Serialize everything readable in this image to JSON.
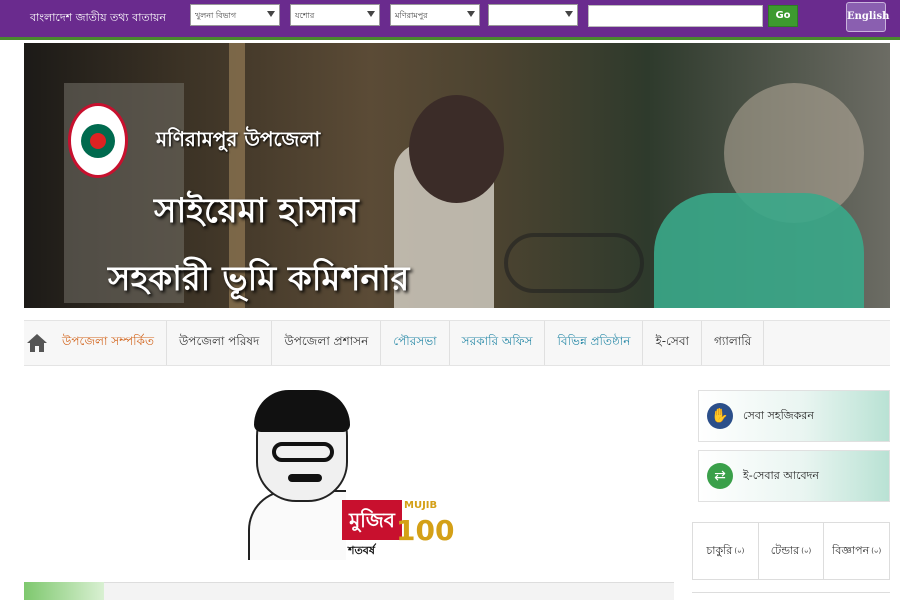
{
  "topbar": {
    "portal_title": "বাংলাদেশ জাতীয় তথ্য বাতায়ন",
    "selects": [
      "খুলনা বিভাগ",
      "যশোর",
      "মণিরামপুর",
      ""
    ],
    "search_value": "",
    "go_label": "Go",
    "lang_label": "English",
    "colors": {
      "bar": "#6a2b8e",
      "go": "#3d9a2f"
    }
  },
  "banner": {
    "upazila": "মণিরামপুর উপজেলা",
    "name": "সাইয়েমা হাসান",
    "role": "সহকারী ভূমি কমিশনার"
  },
  "nav": {
    "home_icon": "home-icon",
    "items": [
      "উপজেলা সম্পর্কিত",
      "উপজেলা পরিষদ",
      "উপজেলা প্রশাসন",
      "পৌরসভা",
      "সরকারি অফিস",
      "বিভিন্ন প্রতিষ্ঠান",
      "ই-সেবা",
      "গ্যালারি"
    ]
  },
  "mujib_logo": {
    "badge": "মুজিব",
    "latin": "MUJIB",
    "hundred": "100",
    "sub": "শতবর্ষ"
  },
  "sidebar": {
    "cards": [
      {
        "label": "সেবা সহজিকরন",
        "icon": "hand-service-icon",
        "color": "#2b4f8a"
      },
      {
        "label": "ই-সেবার আবেদন",
        "icon": "phone-arrows-icon",
        "color": "#3aa04a"
      }
    ],
    "tabs": [
      {
        "label": "চাকুরি",
        "count": "(০)"
      },
      {
        "label": "টেন্ডার",
        "count": "(০)"
      },
      {
        "label": "বিজ্ঞাপন",
        "count": "(০)"
      }
    ]
  }
}
